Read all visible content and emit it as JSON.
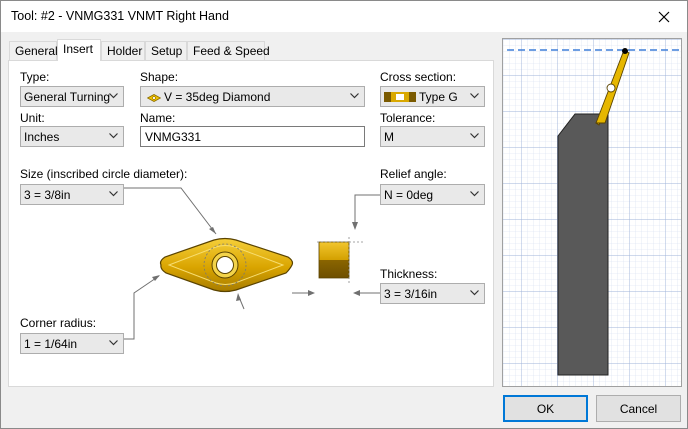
{
  "window": {
    "title": "Tool: #2 - VNMG331 VNMT Right Hand"
  },
  "tabs": [
    {
      "label": "General"
    },
    {
      "label": "Insert"
    },
    {
      "label": "Holder"
    },
    {
      "label": "Setup"
    },
    {
      "label": "Feed & Speed"
    }
  ],
  "fields": {
    "type": {
      "label": "Type:",
      "value": "General Turning"
    },
    "shape": {
      "label": "Shape:",
      "value": "V = 35deg Diamond"
    },
    "cross_section": {
      "label": "Cross section:",
      "value": "Type G"
    },
    "unit": {
      "label": "Unit:",
      "value": "Inches"
    },
    "name": {
      "label": "Name:",
      "value": "VNMG331"
    },
    "tolerance": {
      "label": "Tolerance:",
      "value": "M"
    },
    "size": {
      "label": "Size (inscribed circle diameter):",
      "value": "3 = 3/8in"
    },
    "relief_angle": {
      "label": "Relief angle:",
      "value": "N = 0deg"
    },
    "thickness": {
      "label": "Thickness:",
      "value": "3 = 3/16in"
    },
    "corner_radius": {
      "label": "Corner radius:",
      "value": "1 = 1/64in"
    }
  },
  "buttons": {
    "ok": "OK",
    "cancel": "Cancel"
  },
  "colors": {
    "insert_gold": "#e0b000",
    "holder_gray": "#5a5a5a",
    "grid_blue": "#b9c9e8",
    "focus_blue": "#0078d7"
  }
}
